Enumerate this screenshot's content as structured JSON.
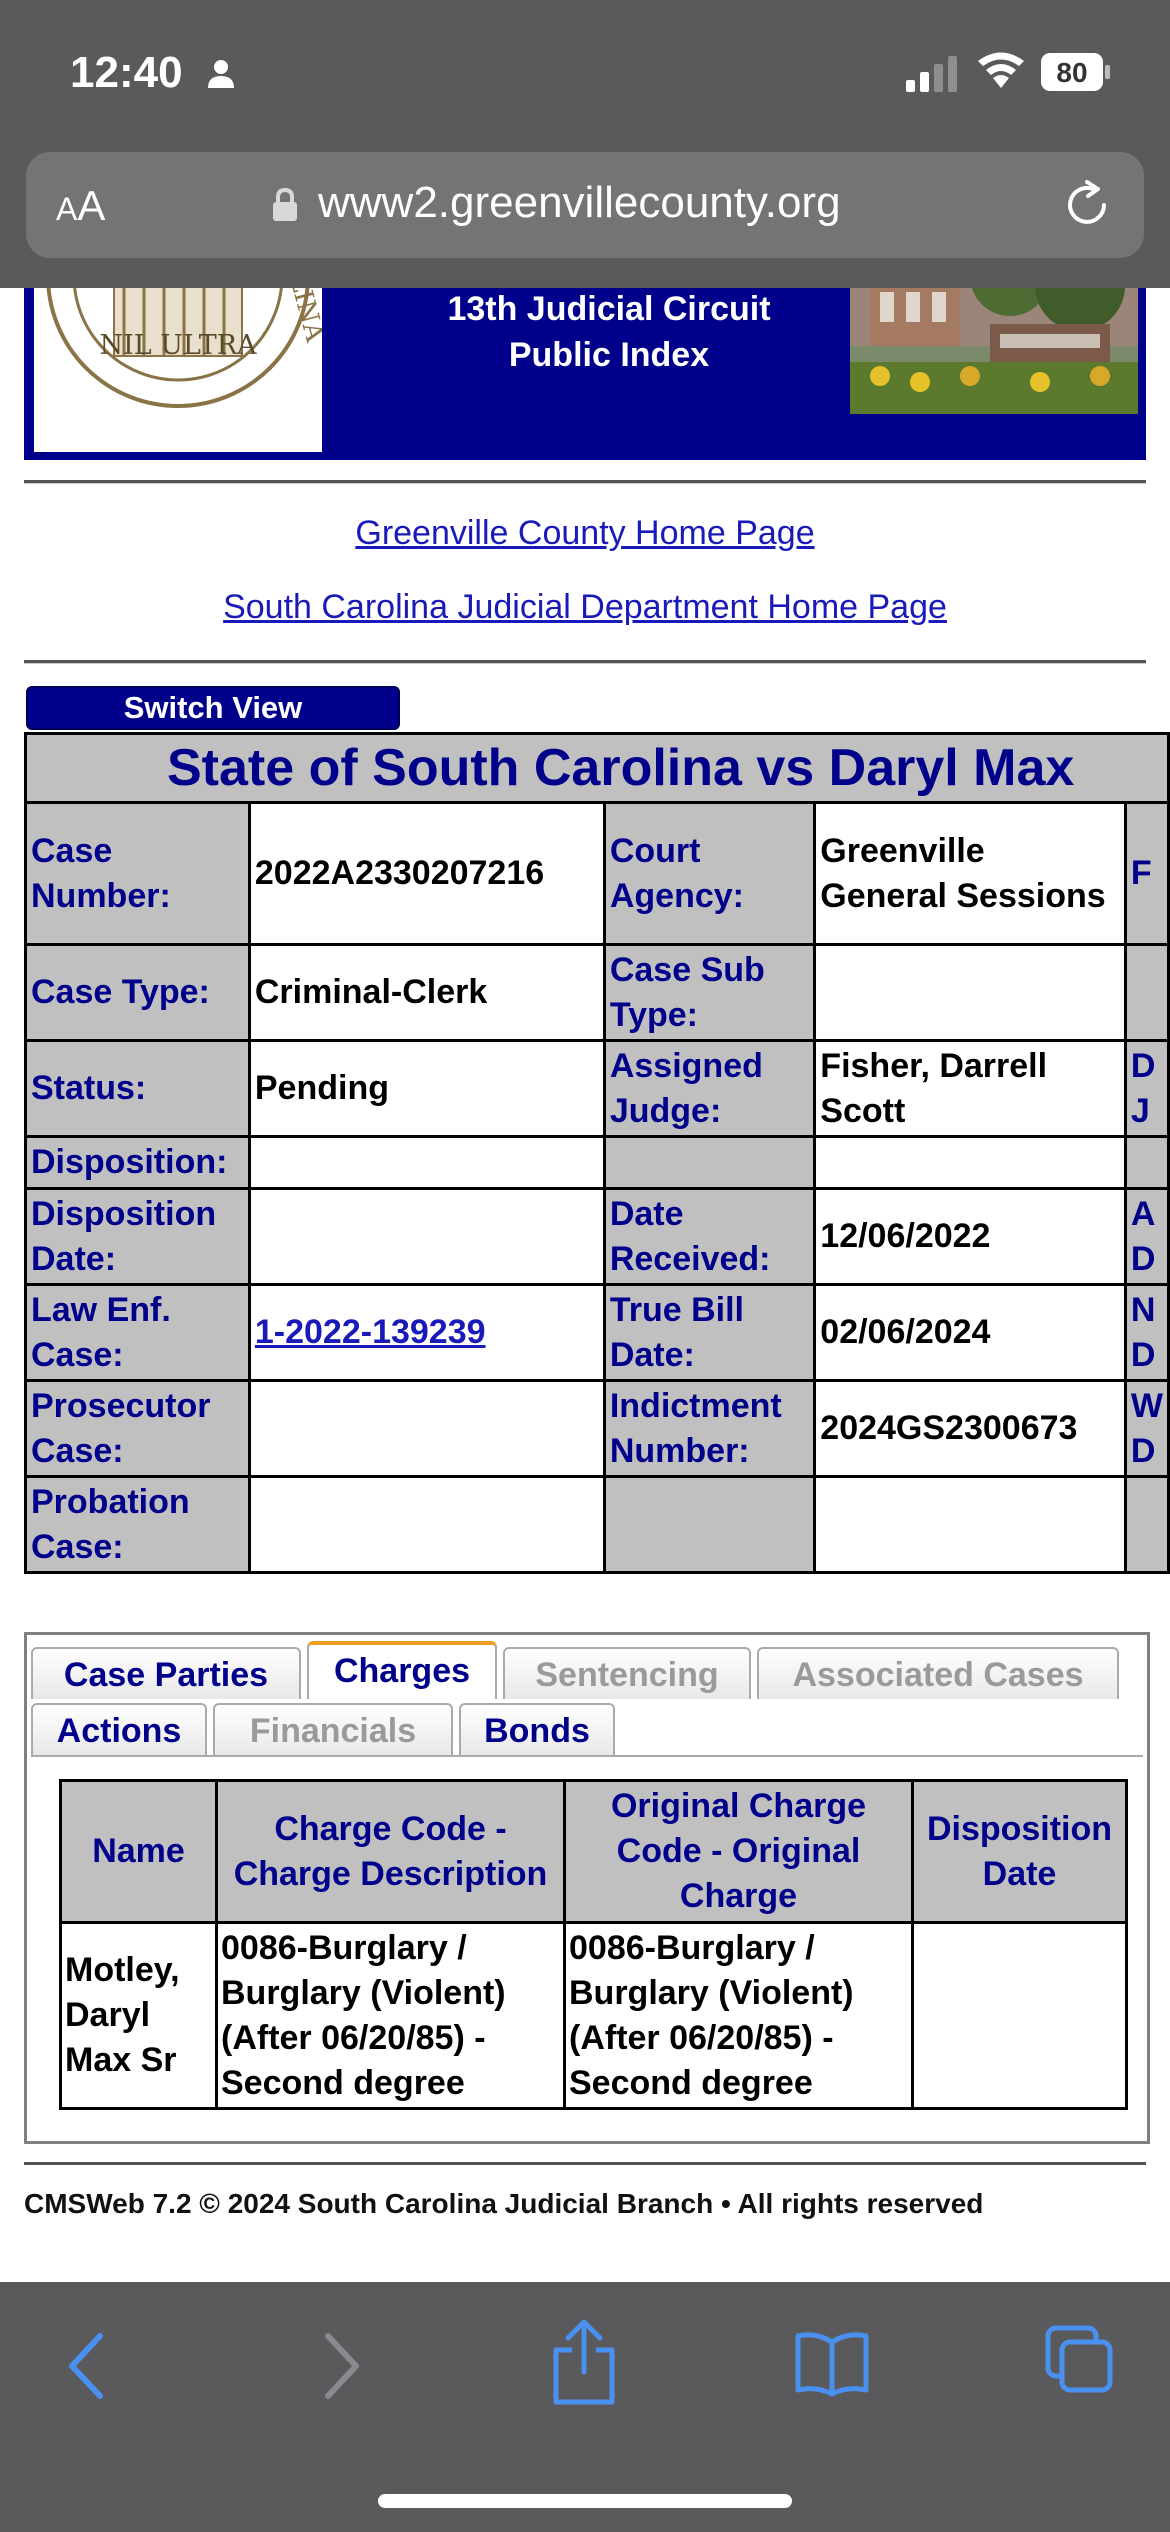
{
  "status_bar": {
    "time": "12:40",
    "battery": "80"
  },
  "browser": {
    "text_size_label_small": "A",
    "text_size_label_large": "A",
    "url": "www2.greenvillecounty.org"
  },
  "banner": {
    "title_line1": "13th Judicial Circuit",
    "title_line2": "Public Index",
    "seal_text": "NIL ULTRA",
    "background_color": "#00008b"
  },
  "links": {
    "county_home": "Greenville County Home Page",
    "judicial_home": "South Carolina Judicial Department Home Page"
  },
  "switch_view_label": "Switch View",
  "case": {
    "title": "State of South Carolina vs Daryl Max",
    "rows": [
      {
        "l1": "Case Number:",
        "v1": "2022A2330207216",
        "l2": "Court Agency:",
        "v2": "Greenville General Sessions",
        "c5": "F"
      },
      {
        "l1": "Case Type:",
        "v1": "Criminal-Clerk",
        "l2": "Case Sub Type:",
        "v2": "",
        "c5": ""
      },
      {
        "l1": "Status:",
        "v1": "Pending",
        "l2": "Assigned Judge:",
        "v2": "Fisher, Darrell Scott",
        "c5": "D J"
      },
      {
        "l1": "Disposition:",
        "v1": "",
        "l2": "",
        "v2": "",
        "c5": ""
      },
      {
        "l1": "Disposition Date:",
        "v1": "",
        "l2": "Date Received:",
        "v2": "12/06/2022",
        "c5": "A D"
      },
      {
        "l1": "Law Enf. Case:",
        "v1": "1-2022-139239",
        "l2": "True Bill Date:",
        "v2": "02/06/2024",
        "c5": "N D"
      },
      {
        "l1": "Prosecutor Case:",
        "v1": "",
        "l2": "Indictment Number:",
        "v2": "2024GS2300673",
        "c5": "W D"
      },
      {
        "l1": "Probation Case:",
        "v1": "",
        "l2": "",
        "v2": "",
        "c5": ""
      }
    ]
  },
  "tabs": [
    {
      "label": "Case Parties",
      "enabled": true
    },
    {
      "label": "Charges",
      "enabled": true,
      "active": true
    },
    {
      "label": "Sentencing",
      "enabled": false
    },
    {
      "label": "Associated Cases",
      "enabled": false
    },
    {
      "label": "Actions",
      "enabled": true
    },
    {
      "label": "Financials",
      "enabled": false
    },
    {
      "label": "Bonds",
      "enabled": true
    }
  ],
  "charges": {
    "headers": [
      "Name",
      "Charge Code - Charge Description",
      "Original Charge Code - Original Charge",
      "Disposition Date"
    ],
    "rows": [
      {
        "name": "Motley, Daryl Max Sr",
        "charge": "0086-Burglary / Burglary (Violent) (After 06/20/85) - Second degree",
        "original": "0086-Burglary / Burglary (Violent) (After 06/20/85) - Second degree",
        "disposition_date": ""
      }
    ]
  },
  "footer": "CMSWeb 7.2 © 2024 South Carolina Judicial Branch • All rights reserved"
}
